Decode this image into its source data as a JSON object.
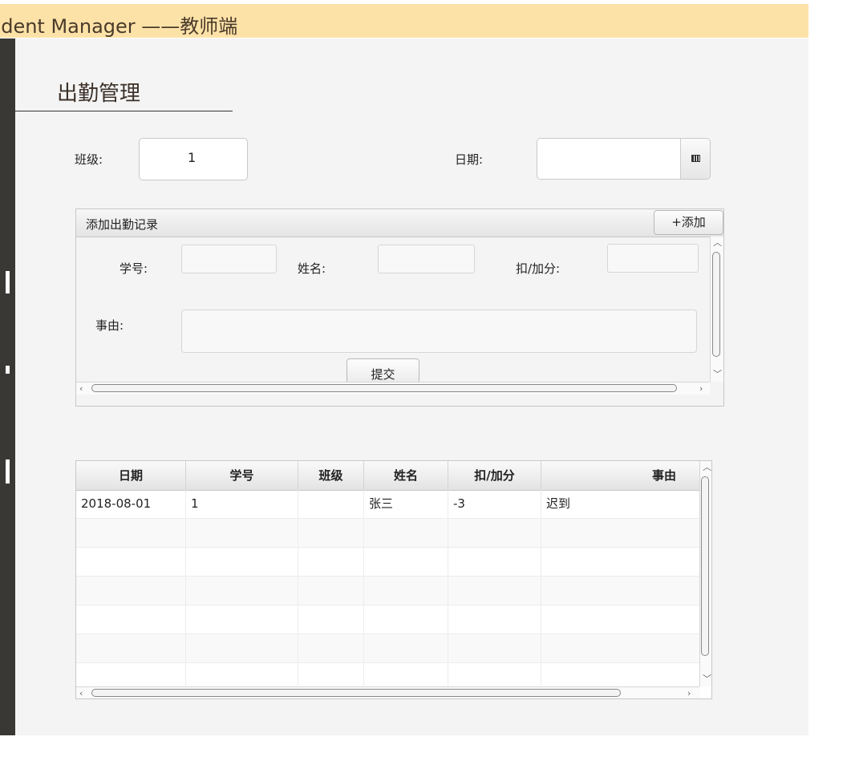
{
  "window": {
    "title": "udent Manager ——教师端"
  },
  "page": {
    "title": "出勤管理"
  },
  "filters": {
    "class_label": "班级:",
    "class_value": "1",
    "date_label": "日期:",
    "date_value": ""
  },
  "add_panel": {
    "title": "添加出勤记录",
    "add_button": "+添加",
    "student_id_label": "学号:",
    "name_label": "姓名:",
    "points_label": "扣/加分:",
    "reason_label": "事由:",
    "submit_button": "提交"
  },
  "table": {
    "columns": [
      "日期",
      "学号",
      "班级",
      "姓名",
      "扣/加分",
      "事由"
    ],
    "rows": [
      [
        "2018-08-01",
        "1",
        "",
        "张三",
        "-3",
        "迟到"
      ]
    ]
  }
}
